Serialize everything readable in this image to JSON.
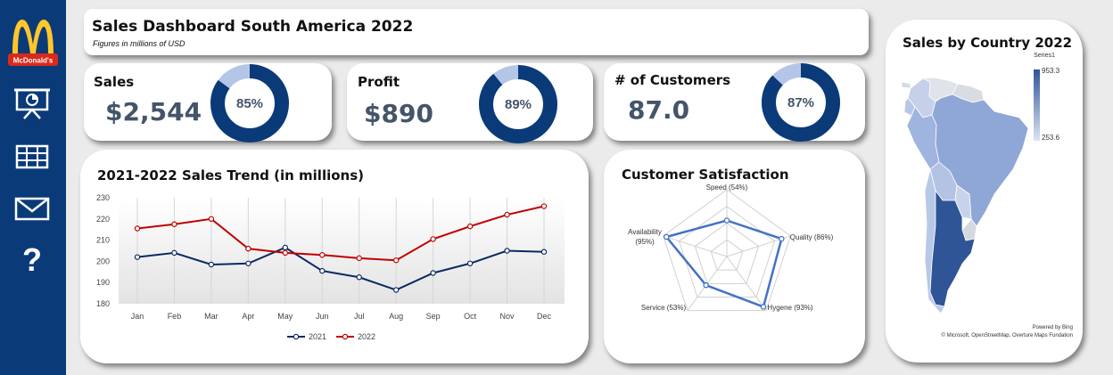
{
  "header": {
    "title": "Sales Dashboard South America 2022",
    "subtitle": "Figures in millions of USD"
  },
  "brand": {
    "logo_text": "McDonald's",
    "primary": "#0b3a78",
    "yellow": "#ffc72c",
    "red": "#da291c"
  },
  "sidebar": {
    "items": [
      {
        "name": "presentation-icon"
      },
      {
        "name": "table-icon"
      },
      {
        "name": "mail-icon"
      },
      {
        "name": "help-icon"
      }
    ]
  },
  "kpis": [
    {
      "label": "Sales",
      "value": "$2,544",
      "percent_label": "85%",
      "percent": 85
    },
    {
      "label": "Profit",
      "value": "$890",
      "percent_label": "89%",
      "percent": 89
    },
    {
      "label": "# of Customers",
      "value": "87.0",
      "percent_label": "87%",
      "percent": 87
    }
  ],
  "colors": {
    "donut_fill": "#0b3a78",
    "donut_rest": "#b4c6e7",
    "line_2021": "#0b2a63",
    "line_2022": "#c00000",
    "radar": "#4472c4",
    "map_high": "#2f5597",
    "map_low": "#dbe4f3"
  },
  "trend": {
    "title": "2021-2022 Sales Trend (in millions)",
    "chart_data": {
      "type": "line",
      "categories": [
        "Jan",
        "Feb",
        "Mar",
        "Apr",
        "May",
        "Jun",
        "Jul",
        "Aug",
        "Sep",
        "Oct",
        "Nov",
        "Dec"
      ],
      "series": [
        {
          "name": "2021",
          "values": [
            202,
            204,
            198.5,
            199,
            206.5,
            195.5,
            192.5,
            186.5,
            194.5,
            199,
            205,
            204.5
          ]
        },
        {
          "name": "2022",
          "values": [
            215.5,
            217.5,
            220,
            206,
            204,
            203,
            201.5,
            200.5,
            210.5,
            216.5,
            222,
            226
          ]
        }
      ],
      "yticks": [
        "180",
        "190",
        "200",
        "210",
        "220",
        "230"
      ],
      "ylim": [
        180,
        230
      ],
      "grid": true,
      "legend": "bottom"
    }
  },
  "satisfaction": {
    "title": "Customer Satisfaction",
    "chart_data": {
      "type": "radar",
      "categories": [
        "Speed (54%)",
        "Quality (86%)",
        "Hygene (93%)",
        "Service (53%)",
        "Availability (95%)"
      ],
      "values": [
        54,
        86,
        93,
        53,
        95
      ],
      "rlim": [
        0,
        100
      ],
      "rings": 4
    }
  },
  "map": {
    "title": "Sales by Country 2022",
    "legend_title": "Series1",
    "legend_max": "953.3",
    "legend_min": "253.6",
    "powered": "Powered by Bing",
    "attribution": "© Microsoft, OpenStreetMap, Overture Maps Fundation"
  }
}
